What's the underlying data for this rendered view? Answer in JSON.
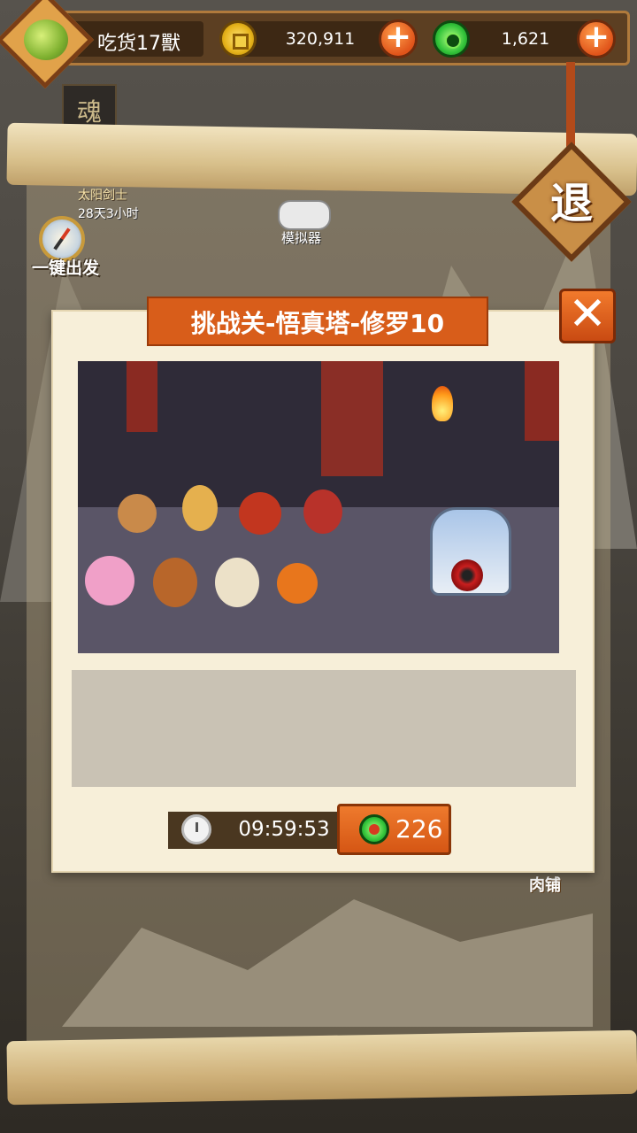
{
  "hud": {
    "player_name": "吃货17獸",
    "gold": "320,911",
    "jade": "1,621"
  },
  "map": {
    "soul_tag": "魂",
    "quest_label": "太阳剑士",
    "quest_time": "28天3小时",
    "depart_label": "一键出发",
    "emulator_label": "模拟器",
    "shop_label": "肉铺",
    "exit_label": "退"
  },
  "dialog": {
    "title": "挑战关-悟真塔-修罗10",
    "close_symbol": "✕",
    "timer": "09:59:53",
    "cost": "226"
  },
  "colors": {
    "accent_orange": "#d85d1a",
    "panel_bg": "#f7efd9",
    "hud_brown": "#5c3f22"
  }
}
